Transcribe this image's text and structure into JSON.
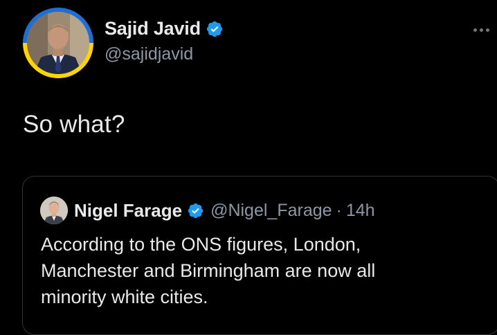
{
  "tweet": {
    "author": {
      "name": "Sajid Javid",
      "handle": "@sajidjavid",
      "avatar_icon": "profile-photo",
      "avatar_ring_colors": [
        "#1d6fd8",
        "#ffd500"
      ],
      "verified_icon": "verified-badge-icon"
    },
    "text": "So what?",
    "more_icon": "more-options-icon"
  },
  "quoted_tweet": {
    "author": {
      "name": "Nigel Farage",
      "handle": "@Nigel_Farage",
      "avatar_icon": "profile-photo",
      "verified_icon": "verified-badge-icon"
    },
    "separator": "·",
    "time": "14h",
    "text_lines": [
      "According to the ONS figures, London,",
      "Manchester and Birmingham are now all",
      "minority white cities."
    ]
  },
  "colors": {
    "background": "#000000",
    "text_primary": "#e7e9ea",
    "text_secondary": "#8b98a5",
    "verified_blue": "#1d9bf0",
    "card_border": "#2f3336"
  }
}
